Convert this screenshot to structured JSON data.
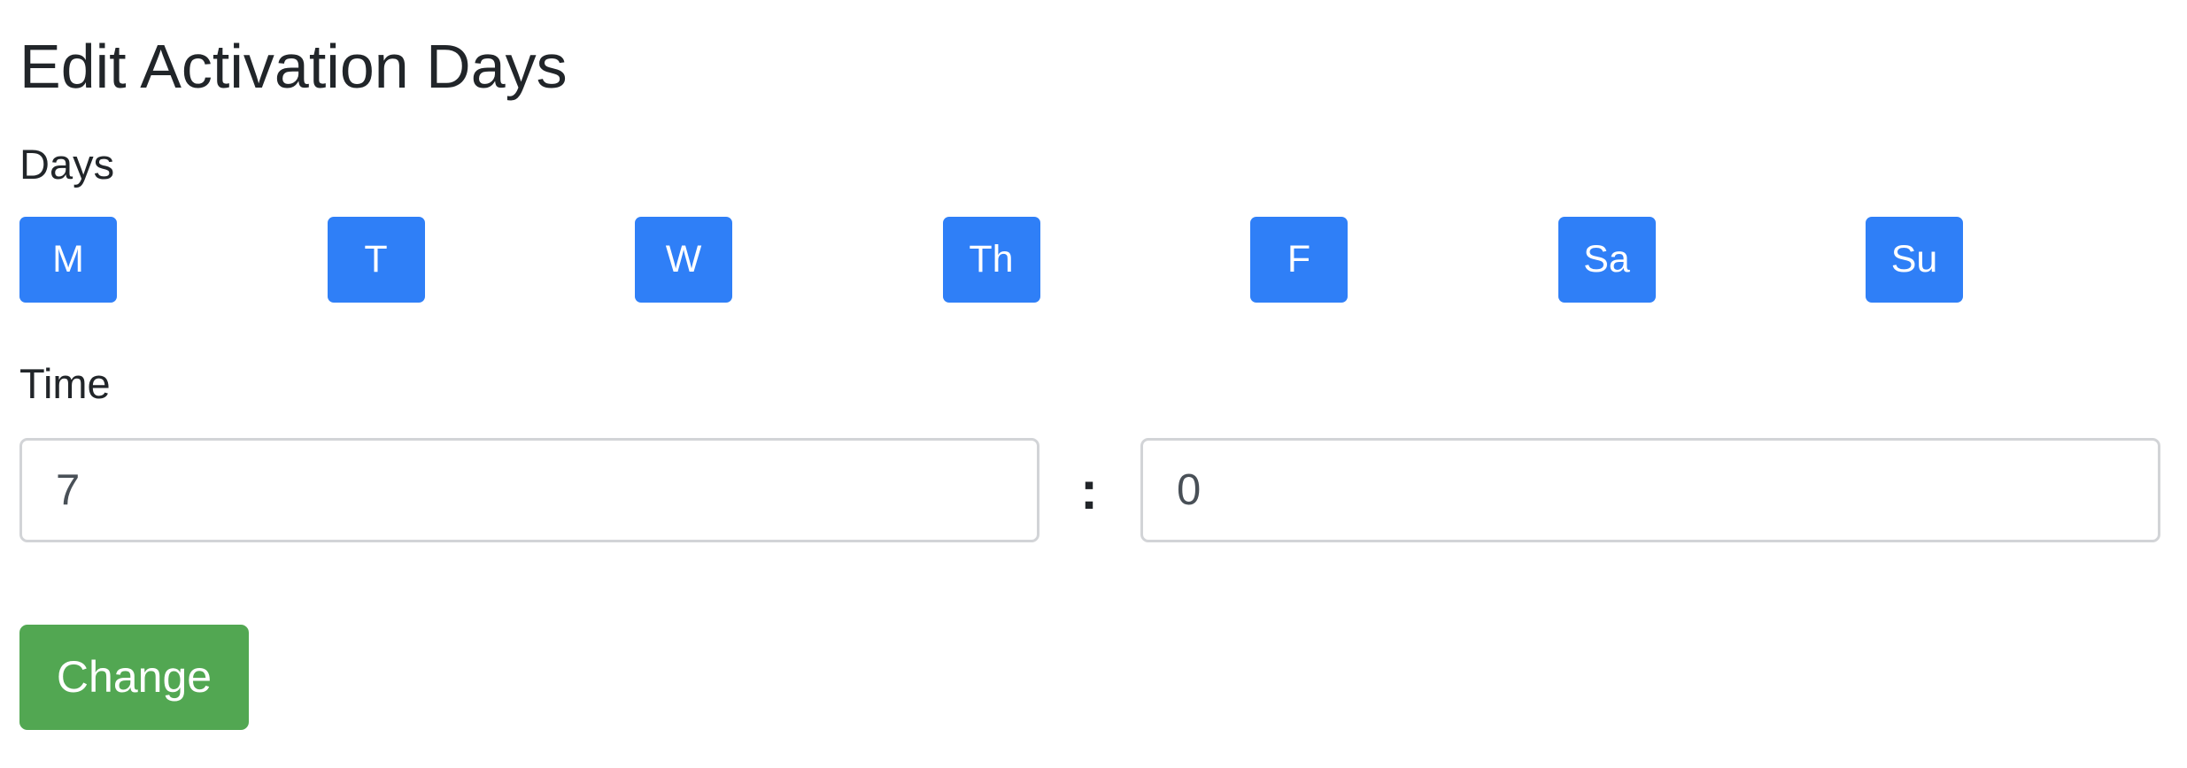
{
  "page": {
    "title": "Edit Activation Days"
  },
  "days": {
    "label": "Days",
    "buttons": [
      "M",
      "T",
      "W",
      "Th",
      "F",
      "Sa",
      "Su"
    ],
    "active_color": "#2f7ff7"
  },
  "time": {
    "label": "Time",
    "hour_value": "7",
    "separator": ":",
    "minute_value": "0"
  },
  "actions": {
    "change_label": "Change",
    "change_color": "#52a752"
  }
}
